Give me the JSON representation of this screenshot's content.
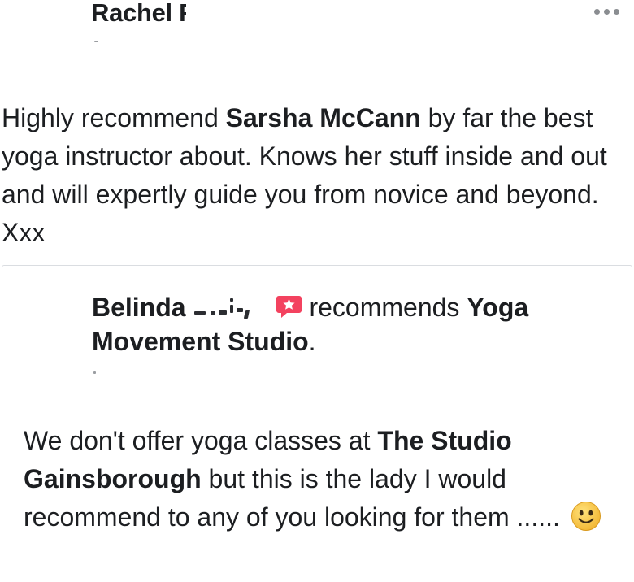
{
  "post": {
    "author": "Rachel F",
    "more_icon": "ellipsis-icon",
    "body": {
      "intro": "Highly recommend ",
      "tagged": "Sarsha McCann",
      "rest": " by far the best yoga instructor about. Knows her stuff inside and out and will expertly guide you from novice and beyond. Xxx"
    }
  },
  "shared": {
    "author": "Belinda",
    "badge_icon": "recommendation-star-icon",
    "action": "recommends ",
    "page_name": "Yoga Movement Studio",
    "period": ".",
    "body": {
      "intro": "We don't offer yoga classes at ",
      "studio": "The Studio Gainsborough",
      "rest": " but this is the lady I would recommend to any of you looking for them ...... ",
      "emoji_icon": "smiling-face-emoji-icon"
    },
    "colors": {
      "badge": "#f3425f",
      "emoji": "#f7c948"
    }
  }
}
